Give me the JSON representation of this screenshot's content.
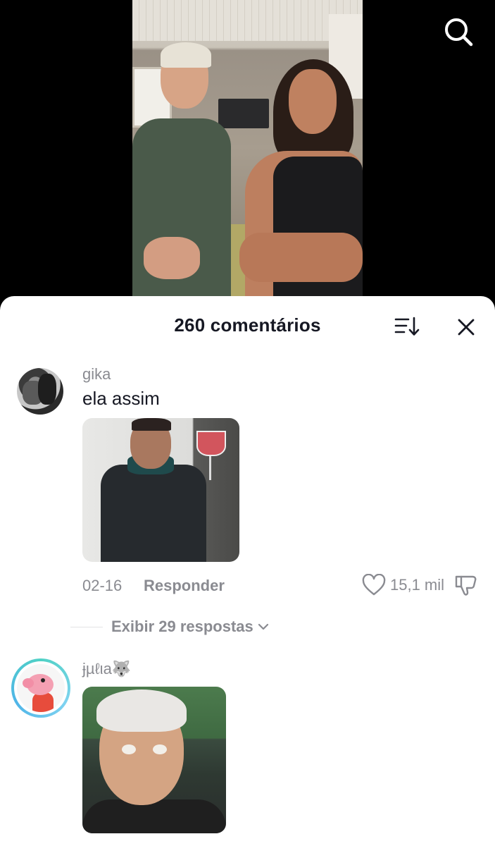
{
  "sheet": {
    "title": "260 comentários"
  },
  "comments": [
    {
      "username": "gika",
      "text": "ela assim",
      "date": "02-16",
      "reply_label": "Responder",
      "like_count": "15,1 mil",
      "view_replies_label": "Exibir 29 respostas"
    },
    {
      "username": "ɉµℓιa🐺"
    }
  ],
  "icons": {
    "search": "search-icon",
    "sort": "sort-icon",
    "close": "close-icon",
    "like": "heart-icon",
    "dislike": "dislike-icon",
    "chevron": "chevron-down-icon"
  },
  "colors": {
    "text_primary": "#161823",
    "text_secondary": "#8a8b91",
    "sheet_bg": "#ffffff",
    "avatar_ring": "#4fd1c5"
  }
}
